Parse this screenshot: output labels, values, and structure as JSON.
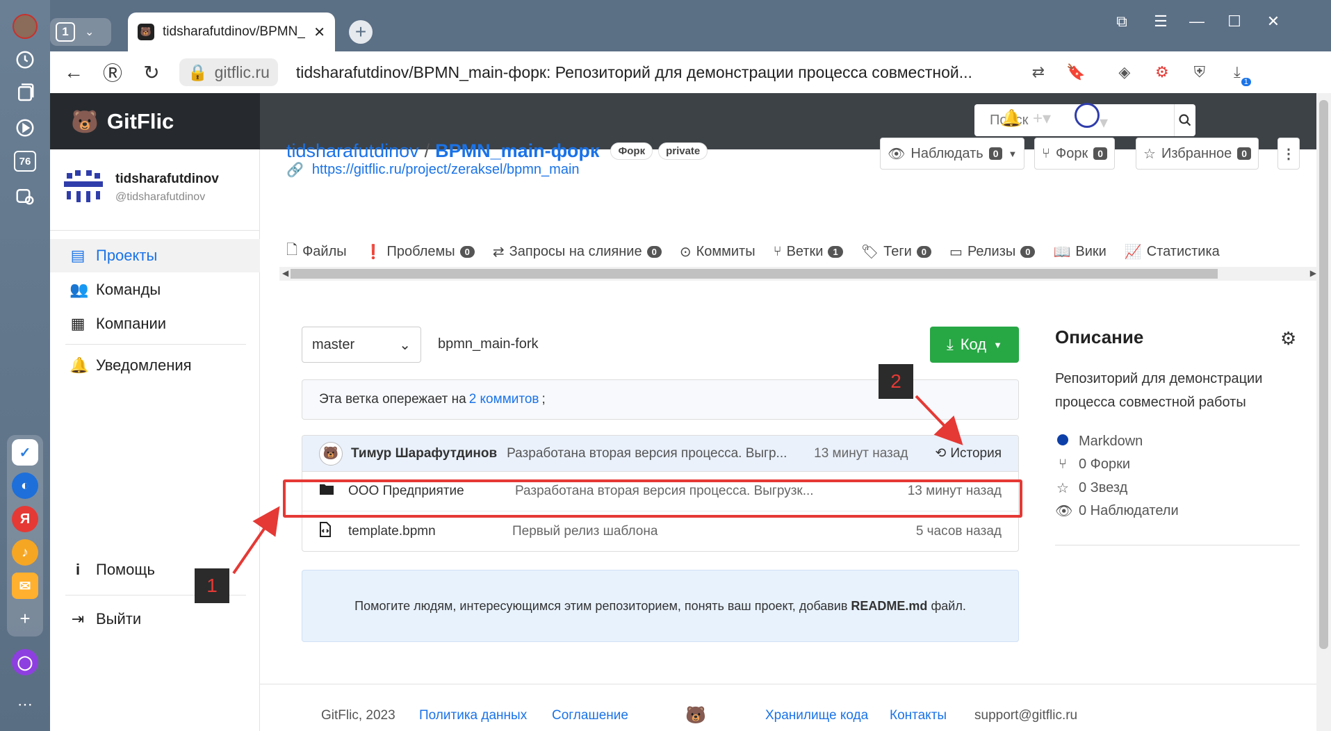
{
  "browser": {
    "tab_count": "1",
    "tab_title": "tidsharafutdinov/BPMN_",
    "address_host": "gitflic.ru",
    "address_title": "tidsharafutdinov/BPMN_main-форк: Репозиторий для демонстрации процесса совместной...",
    "strip_badge": "76",
    "download_badge": "1"
  },
  "site": {
    "logo_text": "GitFlic",
    "search_placeholder": "Поиск"
  },
  "user": {
    "name": "tidsharafutdinov",
    "handle": "@tidsharafutdinov"
  },
  "nav": {
    "projects": "Проекты",
    "teams": "Команды",
    "companies": "Компании",
    "notifications": "Уведомления",
    "help": "Помощь",
    "logout": "Выйти"
  },
  "repo": {
    "owner": "tidsharafutdinov",
    "separator": "/",
    "name": "BPMN_main-форк",
    "badge_fork": "Форк",
    "badge_private": "private",
    "url": "https://gitflic.ru/project/zeraksel/bpmn_main",
    "watch_label": "Наблюдать",
    "watch_count": "0",
    "fork_label": "Форк",
    "fork_count": "0",
    "star_label": "Избранное",
    "star_count": "0"
  },
  "tabs": [
    {
      "label": "Файлы",
      "count": ""
    },
    {
      "label": "Проблемы",
      "count": "0"
    },
    {
      "label": "Запросы на слияние",
      "count": "0"
    },
    {
      "label": "Коммиты",
      "count": ""
    },
    {
      "label": "Ветки",
      "count": "1"
    },
    {
      "label": "Теги",
      "count": "0"
    },
    {
      "label": "Релизы",
      "count": "0"
    },
    {
      "label": "Вики",
      "count": ""
    },
    {
      "label": "Статистика",
      "count": ""
    }
  ],
  "branch": {
    "selected": "master",
    "path": "bpmn_main-fork",
    "code_button": "Код"
  },
  "ahead": {
    "prefix": "Эта ветка опережает на",
    "link": "2 коммитов",
    "suffix": ";"
  },
  "last_commit": {
    "author": "Тимур Шарафутдинов",
    "message": "Разработана вторая версия процесса. Выгр...",
    "time": "13 минут назад",
    "history": "История"
  },
  "files": [
    {
      "name": "ООО Предприятие",
      "message": "Разработана вторая версия процесса. Выгрузк...",
      "time": "13 минут назад",
      "type": "folder"
    },
    {
      "name": "template.bpmn",
      "message": "Первый релиз шаблона",
      "time": "5 часов назад",
      "type": "file"
    }
  ],
  "readme": {
    "prefix": "Помогите людям, интересующимся этим репозиторием, понять ваш проект, добавив",
    "file": "README.md",
    "suffix": "файл."
  },
  "description": {
    "title": "Описание",
    "text": "Репозиторий для демонстрации процесса совместной работы",
    "language": "Markdown",
    "forks": "0 Форки",
    "stars": "0 Звезд",
    "watchers": "0 Наблюдатели"
  },
  "footer": {
    "copyright": "GitFlic, 2023",
    "privacy": "Политика данных",
    "agreement": "Соглашение",
    "storage": "Хранилище кода",
    "contacts": "Контакты",
    "email": "support@gitflic.ru"
  },
  "annotations": {
    "label_1": "1",
    "label_2": "2",
    "color": "#e53935"
  },
  "colors": {
    "link": "#1a73e8",
    "code_button": "#28a745",
    "header_dark": "#262a2e"
  }
}
